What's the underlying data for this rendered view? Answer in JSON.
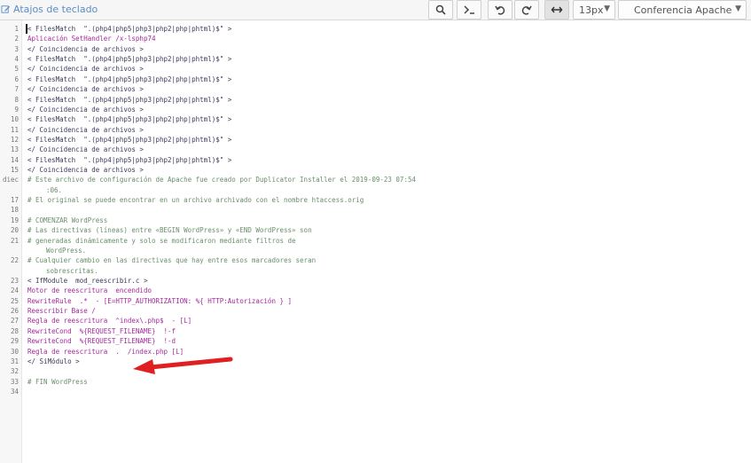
{
  "toolbar": {
    "shortcuts_label": "Atajos de teclado",
    "font_size": "13px",
    "mode": "Conferencia Apache",
    "accent_color": "#5b8ec4"
  },
  "editor": {
    "lines": [
      {
        "n": "1",
        "text": "< FilesMatch  \".(php4|php5|php3|php2|php|phtml)$\" >",
        "style": "tag"
      },
      {
        "n": "2",
        "text": "Aplicación SetHandler /x-lsphp74",
        "style": "attr"
      },
      {
        "n": "3",
        "text": "</ Coincidencia de archivos >",
        "style": "tag"
      },
      {
        "n": "4",
        "text": "< FilesMatch  \".(php4|php5|php3|php2|php|phtml)$\" >",
        "style": "tag"
      },
      {
        "n": "5",
        "text": "</ Coincidencia de archivos >",
        "style": "tag"
      },
      {
        "n": "6",
        "text": "< FilesMatch  \".(php4|php5|php3|php2|php|phtml)$\" >",
        "style": "tag"
      },
      {
        "n": "7",
        "text": "</ Coincidencia de archivos >",
        "style": "tag"
      },
      {
        "n": "8",
        "text": "< FilesMatch  \".(php4|php5|php3|php2|php|phtml)$\" >",
        "style": "tag"
      },
      {
        "n": "9",
        "text": "</ Coincidencia de archivos >",
        "style": "tag"
      },
      {
        "n": "10",
        "text": "< FilesMatch  \".(php4|php5|php3|php2|php|phtml)$\" >",
        "style": "tag"
      },
      {
        "n": "11",
        "text": "</ Coincidencia de archivos >",
        "style": "tag"
      },
      {
        "n": "12",
        "text": "< FilesMatch  \".(php4|php5|php3|php2|php|phtml)$\" >",
        "style": "tag"
      },
      {
        "n": "13",
        "text": "</ Coincidencia de archivos >",
        "style": "tag"
      },
      {
        "n": "14",
        "text": "< FilesMatch  \".(php4|php5|php3|php2|php|phtml)$\" >",
        "style": "tag"
      },
      {
        "n": "15",
        "text": "</ Coincidencia de archivos >",
        "style": "tag"
      },
      {
        "n": "diec",
        "text": "# Este archivo de configuración de Apache fue creado por Duplicator Installer el 2019-09-23 07:54",
        "style": "comment"
      },
      {
        "n": "",
        "text": ":06.",
        "style": "comment",
        "cont": true
      },
      {
        "n": "17",
        "text": "# El original se puede encontrar en un archivo archivado con el nombre htaccess.orig",
        "style": "comment"
      },
      {
        "n": "18",
        "text": "",
        "style": "plain"
      },
      {
        "n": "19",
        "text": "# COMENZAR WordPress",
        "style": "comment"
      },
      {
        "n": "20",
        "text": "# Las directivas (líneas) entre «BEGIN WordPress» y «END WordPress» son",
        "style": "comment"
      },
      {
        "n": "21",
        "text": "# generadas dinámicamente y solo se modificaron mediante filtros de",
        "style": "comment"
      },
      {
        "n": "",
        "text": "WordPress.",
        "style": "comment",
        "cont": true
      },
      {
        "n": "22",
        "text": "# Cualquier cambio en las directivas que hay entre esos marcadores seran",
        "style": "comment"
      },
      {
        "n": "",
        "text": "sobrescritas.",
        "style": "comment",
        "cont": true
      },
      {
        "n": "23",
        "text": "< IfModule  mod_reescribir.c >",
        "style": "tag"
      },
      {
        "n": "24",
        "text": "Motor de reescritura  encendido",
        "style": "attr"
      },
      {
        "n": "25",
        "text": "RewriteRule  .*  - [E=HTTP_AUTHORIZATION: %{ HTTP:Autorización } ]",
        "style": "attr"
      },
      {
        "n": "26",
        "text": "Reescribir Base /",
        "style": "attr"
      },
      {
        "n": "27",
        "text": "Regla de reescritura  ^index\\.php$  - [L]",
        "style": "attr"
      },
      {
        "n": "28",
        "text": "RewriteCond  %{REQUEST_FILENAME}  !-f",
        "style": "attr"
      },
      {
        "n": "29",
        "text": "RewriteCond  %{REQUEST_FILENAME}  !-d",
        "style": "attr"
      },
      {
        "n": "30",
        "text": "Regla de reescritura  .  /index.php [L]",
        "style": "attr"
      },
      {
        "n": "31",
        "text": "</ SiMódulo >",
        "style": "tag"
      },
      {
        "n": "32",
        "text": "",
        "style": "plain"
      },
      {
        "n": "33",
        "text": "# FIN WordPress",
        "style": "comment"
      },
      {
        "n": "34",
        "text": "",
        "style": "plain"
      }
    ]
  },
  "annotation": {
    "arrow_color": "#e02020"
  }
}
